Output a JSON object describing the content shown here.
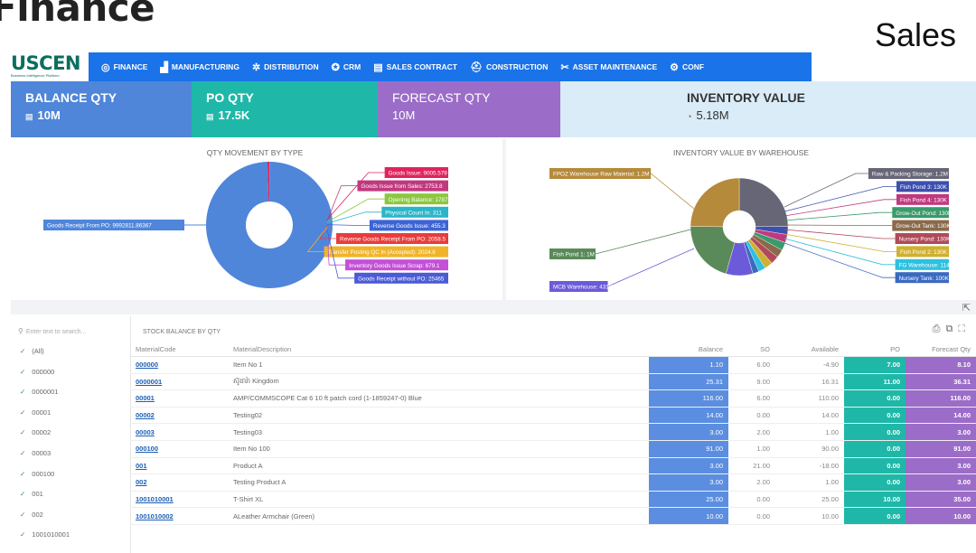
{
  "page": {
    "heading_left": "Finance",
    "heading_right": "Sales"
  },
  "colors": {
    "nav": "#1a73e8",
    "balance": "#4f86d9",
    "po": "#1fb8a8",
    "forecast": "#9b6dc8",
    "inventory": "#d9ecf8"
  },
  "logo": {
    "text": "USCEN",
    "tagline": "Business Intelligence Platform"
  },
  "nav": {
    "items": [
      {
        "label": "FINANCE",
        "icon": "chart-icon"
      },
      {
        "label": "MANUFACTURING",
        "icon": "factory-icon"
      },
      {
        "label": "DISTRIBUTION",
        "icon": "gear-icon"
      },
      {
        "label": "CRM",
        "icon": "crm-icon"
      },
      {
        "label": "SALES CONTRACT",
        "icon": "document-icon"
      },
      {
        "label": "CONSTRUCTION",
        "icon": "construction-icon"
      },
      {
        "label": "ASSET MAINTENANCE",
        "icon": "tools-icon"
      },
      {
        "label": "CONF",
        "icon": "settings-icon"
      }
    ]
  },
  "kpis": [
    {
      "label": "BALANCE QTY",
      "value": "10M"
    },
    {
      "label": "PO QTY",
      "value": "17.5K"
    },
    {
      "label": "FORECAST QTY",
      "value": "10M"
    },
    {
      "label": "INVENTORY VALUE",
      "value": "5.18M"
    }
  ],
  "charts": {
    "qty_movement": {
      "title": "QTY MOVEMENT BY TYPE",
      "left_label": {
        "text": "Goods Receipt From PO: 9992811.86367",
        "color": "#4f86d9"
      },
      "callouts": [
        {
          "text": "Goods Issue: 9005.579",
          "color": "#e0245e"
        },
        {
          "text": "Goods Issue from Sales: 2753.8",
          "color": "#c0397e"
        },
        {
          "text": "Opening Balance: 1787",
          "color": "#8cc63f"
        },
        {
          "text": "Physical Count In: 311",
          "color": "#2bb5c8"
        },
        {
          "text": "Reverse Goods Issue: 455.3",
          "color": "#3d64d6"
        },
        {
          "text": "Reverse Goods Receipt From PO: 2058.5",
          "color": "#e83c3c"
        },
        {
          "text": "Transfer Posting QC In (Accepted): 2024.8",
          "color": "#f0b429"
        },
        {
          "text": "Inventory Goods Issue Scrap: 679.1",
          "color": "#c44fd8"
        },
        {
          "text": "Goods Receipt without PO: 25465",
          "color": "#4a5bd4"
        }
      ]
    },
    "inventory_value": {
      "title": "INVENTORY VALUE BY WAREHOUSE",
      "left_labels": [
        {
          "text": "FPOZ Warehouse Raw Material: 1.2M",
          "color": "#b58a3a"
        },
        {
          "text": "Fish Pond 1: 1M",
          "color": "#5a8a5a"
        },
        {
          "text": "MCB Warehouse: 431K",
          "color": "#6b5bd8"
        }
      ],
      "right_labels": [
        {
          "text": "Raw & Packing Storage: 1.2M",
          "color": "#666677"
        },
        {
          "text": "Fish Pond 3: 130K",
          "color": "#3d4fb0"
        },
        {
          "text": "Fish Pond 4: 130K",
          "color": "#c0397e"
        },
        {
          "text": "Grow-Out Pond: 130K",
          "color": "#3a9a6a"
        },
        {
          "text": "Grow-Out Tank: 130K",
          "color": "#8a6a4a"
        },
        {
          "text": "Nursery Pond: 130K",
          "color": "#b04a5a"
        },
        {
          "text": "Fish Pond 2: 130K",
          "color": "#d0b030"
        },
        {
          "text": "FG Warehouse: 114K",
          "color": "#2ec0e0"
        },
        {
          "text": "Nursery Tank: 100K",
          "color": "#3a6ac0"
        }
      ]
    }
  },
  "filter": {
    "search_placeholder": "Enter text to search...",
    "items": [
      "(All)",
      "000000",
      "0000001",
      "00001",
      "00002",
      "00003",
      "000100",
      "001",
      "002",
      "1001010001"
    ]
  },
  "table": {
    "title": "STOCK BALANCE BY QTY",
    "columns": [
      "MaterialCode",
      "MaterialDescription",
      "Balance",
      "SO",
      "Available",
      "PO",
      "Forecast Qty"
    ],
    "rows": [
      {
        "code": "000000",
        "desc": "Item No 1",
        "balance": "1.10",
        "so": "6.00",
        "available": "-4.90",
        "po": "7.00",
        "forecast": "8.10"
      },
      {
        "code": "0000001",
        "desc": "ស៊ូដារ៉ា Kingdom",
        "balance": "25.31",
        "so": "9.00",
        "available": "16.31",
        "po": "11.00",
        "forecast": "36.31"
      },
      {
        "code": "00001",
        "desc": "AMP/COMMSCOPE Cat 6 10 ft patch cord (1-1859247-0) Blue",
        "balance": "116.00",
        "so": "6.00",
        "available": "110.00",
        "po": "0.00",
        "forecast": "116.00"
      },
      {
        "code": "00002",
        "desc": "Testing02",
        "balance": "14.00",
        "so": "0.00",
        "available": "14.00",
        "po": "0.00",
        "forecast": "14.00"
      },
      {
        "code": "00003",
        "desc": "Testing03",
        "balance": "3.00",
        "so": "2.00",
        "available": "1.00",
        "po": "0.00",
        "forecast": "3.00"
      },
      {
        "code": "000100",
        "desc": "Item No 100",
        "balance": "91.00",
        "so": "1.00",
        "available": "90.00",
        "po": "0.00",
        "forecast": "91.00"
      },
      {
        "code": "001",
        "desc": "Product A",
        "balance": "3.00",
        "so": "21.00",
        "available": "-18.00",
        "po": "0.00",
        "forecast": "3.00"
      },
      {
        "code": "002",
        "desc": "Testing Product A",
        "balance": "3.00",
        "so": "2.00",
        "available": "1.00",
        "po": "0.00",
        "forecast": "3.00"
      },
      {
        "code": "1001010001",
        "desc": "T-Shirt XL",
        "balance": "25.00",
        "so": "0.00",
        "available": "25.00",
        "po": "10.00",
        "forecast": "35.00"
      },
      {
        "code": "1001010002",
        "desc": "ALeather Armchair (Green)",
        "balance": "10.00",
        "so": "0.00",
        "available": "10.00",
        "po": "0.00",
        "forecast": "10.00"
      }
    ]
  }
}
